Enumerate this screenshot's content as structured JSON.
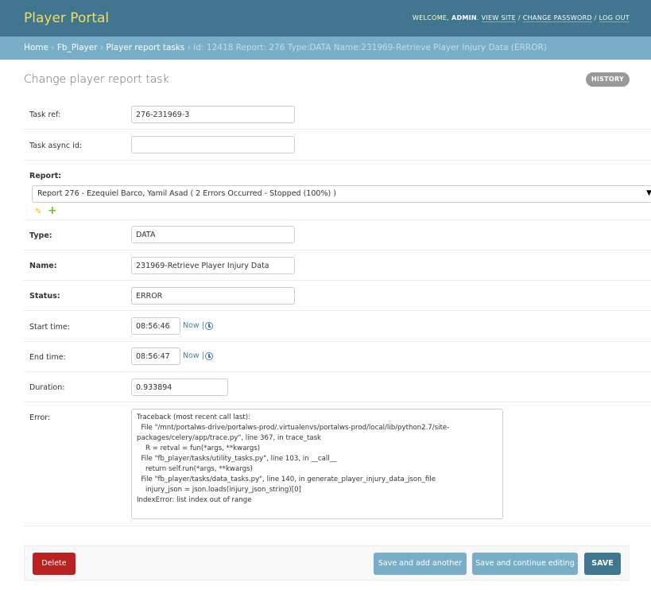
{
  "header": {
    "brand": "Player Portal",
    "welcome": "Welcome,",
    "user": "admin",
    "view_site": "View site",
    "change_password": "Change password",
    "log_out": "Log out",
    "sep1": ". ",
    "sep2": " / ",
    "sep3": " / "
  },
  "breadcrumbs": {
    "home": "Home",
    "app": "Fb_Player",
    "model": "Player report tasks",
    "sep": " › ",
    "current": "Id: 12418 Report: 276 Type:DATA Name:231969-Retrieve Player Injury Data (ERROR)"
  },
  "page": {
    "title": "Change player report task",
    "history": "HISTORY"
  },
  "form": {
    "task_ref": {
      "label": "Task ref:",
      "value": "276-231969-3"
    },
    "task_async_id": {
      "label": "Task async id:",
      "value": ""
    },
    "report": {
      "label": "Report:",
      "selected": "Report 276 - Ezequiel Barco, Yamil Asad ( 2 Errors Occurred - Stopped (100%) )",
      "arrow": "▼",
      "edit_icon": "pencil-icon",
      "add_icon": "plus-icon",
      "edit_glyph": "✎",
      "add_glyph": "+"
    },
    "type": {
      "label": "Type:",
      "value": "DATA"
    },
    "name": {
      "label": "Name:",
      "value": "231969-Retrieve Player Injury Data"
    },
    "status": {
      "label": "Status:",
      "value": "ERROR"
    },
    "start_time": {
      "label": "Start time:",
      "value": "08:56:46",
      "now": "Now |"
    },
    "end_time": {
      "label": "End time:",
      "value": "08:56:47",
      "now": "Now |"
    },
    "duration": {
      "label": "Duration:",
      "value": "0.933894"
    },
    "error": {
      "label": "Error:",
      "value": "Traceback (most recent call last):\n  File \"/mnt/portalws-drive/portalws-prod/.virtualenvs/portalws-prod/local/lib/python2.7/site-packages/celery/app/trace.py\", line 367, in trace_task\n    R = retval = fun(*args, **kwargs)\n  File \"fb_player/tasks/utility_tasks.py\", line 103, in __call__\n    return self.run(*args, **kwargs)\n  File \"fb_player/tasks/data_tasks.py\", line 140, in generate_player_injury_data_json_file\n    injury_json = json.loads(injury_json_string)[0]\nIndexError: list index out of range"
    }
  },
  "submit": {
    "delete": "Delete",
    "save_add": "Save and add another",
    "save_continue": "Save and continue editing",
    "save": "SAVE"
  },
  "colors": {
    "header_bg": "#417690",
    "brand": "#f5dd5d",
    "breadcrumbs_bg": "#79aec8",
    "delete_bg": "#ba2121",
    "save_bg": "#417690"
  }
}
